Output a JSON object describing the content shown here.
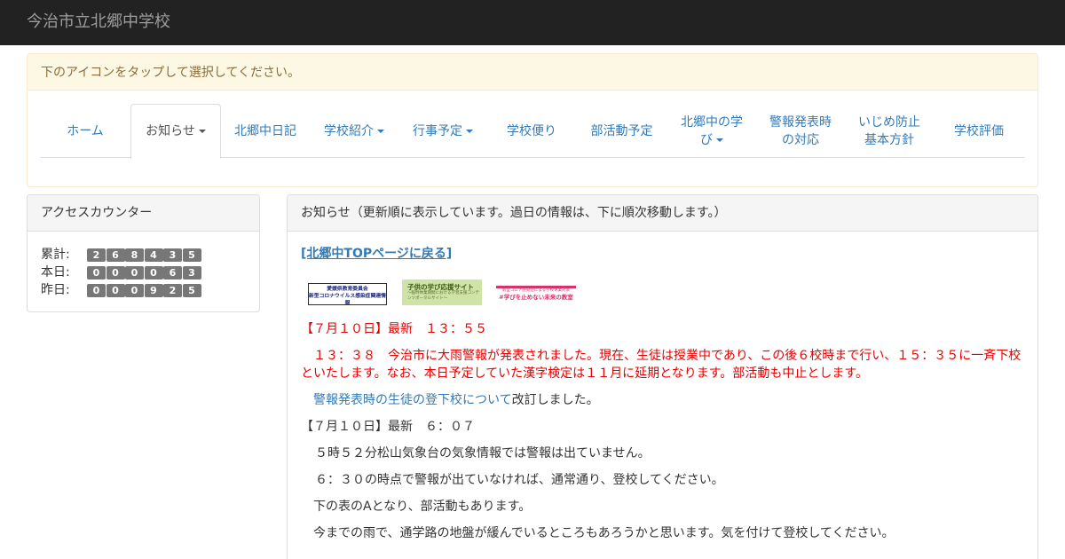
{
  "header": {
    "brand": "今治市立北郷中学校"
  },
  "nav": {
    "hint": "下のアイコンをタップして選択してください。",
    "tabs": [
      {
        "label": "ホーム",
        "dropdown": false,
        "active": false
      },
      {
        "label": "お知らせ",
        "dropdown": true,
        "active": true
      },
      {
        "label": "北郷中日記",
        "dropdown": false,
        "active": false
      },
      {
        "label": "学校紹介",
        "dropdown": true,
        "active": false
      },
      {
        "label": "行事予定",
        "dropdown": true,
        "active": false
      },
      {
        "label": "学校便り",
        "dropdown": false,
        "active": false
      },
      {
        "label": "部活動予定",
        "dropdown": false,
        "active": false
      },
      {
        "label": "北郷中の学",
        "label2": "び",
        "dropdown": true,
        "active": false
      },
      {
        "label": "警報発表時",
        "label2": "の対応",
        "dropdown": false,
        "active": false
      },
      {
        "label": "いじめ防止",
        "label2": "基本方針",
        "dropdown": false,
        "active": false
      },
      {
        "label": "学校評価",
        "dropdown": false,
        "active": false
      }
    ]
  },
  "counter": {
    "title": "アクセスカウンター",
    "rows": [
      {
        "label": "累計:",
        "digits": [
          "2",
          "6",
          "8",
          "4",
          "3",
          "5"
        ]
      },
      {
        "label": "本日:",
        "digits": [
          "0",
          "0",
          "0",
          "0",
          "6",
          "3"
        ]
      },
      {
        "label": "昨日:",
        "digits": [
          "0",
          "0",
          "0",
          "9",
          "2",
          "5"
        ]
      }
    ]
  },
  "news": {
    "title": "お知らせ（更新順に表示しています。過日の情報は、下に順次移動します。）",
    "top_link": "[北郷中TOPページに戻る] ",
    "banners": {
      "b1_line1": "愛媛県教育委員会",
      "b1_line2": "新型コロナウイルス感染症関連情報",
      "b2_line1": "子供の学び応援サイト",
      "b2_line2": "～臨時休業期間における学習支援コンテンツポータルサイト～",
      "b3_line1": "新型コロナ感染症による学校休業対策",
      "b3_line2": "#学びを止めない未来の教室"
    },
    "update1_heading": "【７月１０日】最新　１３：５５",
    "update1_text": "　１３：３８　今治市に大雨警報が発表されました。現在、生徒は授業中であり、この後６校時まで行い、１５：３５に一斉下校といたします。なお、本日予定していた漢字検定は１１月に延期となります。部活動も中止とします。",
    "revision_link": "警報発表時の生徒の登下校について",
    "revision_suffix": "改訂しました。",
    "update2_heading": "【７月１０日】最新　６：０７",
    "update2_lines": [
      "５時５２分松山気象台の気象情報では警報は出ていません。",
      "６：３０の時点で警報が出ていなければ、通常通り、登校してください。",
      "下の表のAとなり、部活動もあります。",
      "今までの雨で、通学路の地盤が緩んでいるところもあろうかと思います。気を付けて登校してください。"
    ]
  },
  "colors": {
    "topbar": "#222222",
    "link": "#337ab7",
    "alert_red": "#e60000",
    "warning_panel_bg": "#fcf8e3",
    "counter_digit_bg": "#777777"
  }
}
